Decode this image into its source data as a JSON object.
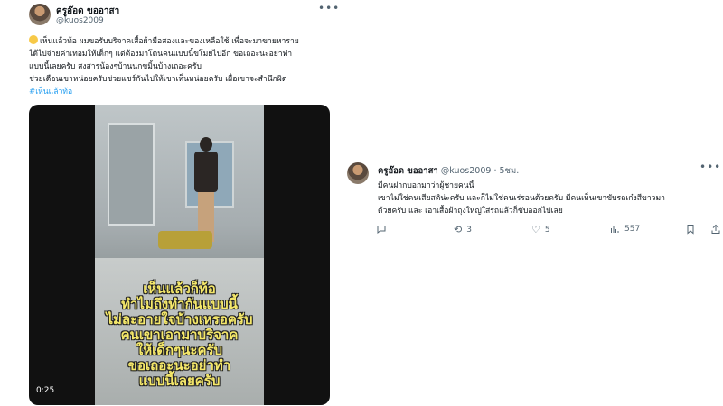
{
  "left_tweet": {
    "author_name": "ครูอ๊อด ขออาสา",
    "author_handle": "@kuos2009",
    "more_icon": "more-horizontal-icon",
    "body_lines": [
      "เห็นแล้วท้อ  ผมขอรับบริจาคเสื้อผ้ามือสองและของเหลือใช้ เพื่อจะมาขายหาราย",
      "ได้ไปจ่ายค่าเทอมให้เด็กๆ แต่ต้องมาโดนคนแบบนี้ขโมยไปอีก  ขอเถอะนะอย่าทำ",
      "แบบนี้เลยครับ สงสารน้องๆบ้านนกขมิ้นบ้างเถอะครับ",
      "ช่วยเตือนเขาหน่อยครับช่วยแชร์กันไปให้เขาเห็นหน่อยครับ เผื่อเขาจะสำนึกผิด"
    ],
    "hashtag": "#เห็นแล้วท้อ",
    "video": {
      "overlay_lines": [
        "เห็นแล้วก็ท้อ",
        "ทำไมถึงทำกันแบบนี้",
        "ไม่ละอายใจบ้างเหรอครับ",
        "คนเขาเอามาบริจาค",
        "ให้เด็กๆนะครับ",
        "ขอเถอะนะอย่าทำ",
        "แบบนี้เลยครับ"
      ],
      "timer": "0:25"
    }
  },
  "reply": {
    "author_name": "ครูอ๊อด ขออาสา",
    "author_handle": "@kuos2009",
    "separator": "·",
    "time": "5ชม.",
    "more_icon": "more-horizontal-icon",
    "body_lines": [
      "มีคนฝากบอกมาว่าผู้ชายคนนี้",
      "เขาไม่ใช่คนเสียสติน่ะครับ และก็ไม่ใช่คนเร่รอนด้วยครับ มีคนเห็นเขาขับรถเก๋งสีขาวมา",
      "ด้วยครับ  และ เอาเสื้อผ้าถุงใหญ่ใส่รถแล้วก็ขับออกไปเลย"
    ],
    "actions": {
      "reply_icon": "reply-icon",
      "retweet_icon": "retweet-icon",
      "retweet_count": "3",
      "like_icon": "like-icon",
      "like_count": "5",
      "views_icon": "views-icon",
      "views_count": "557",
      "bookmark_icon": "bookmark-icon",
      "share_icon": "share-icon"
    }
  }
}
